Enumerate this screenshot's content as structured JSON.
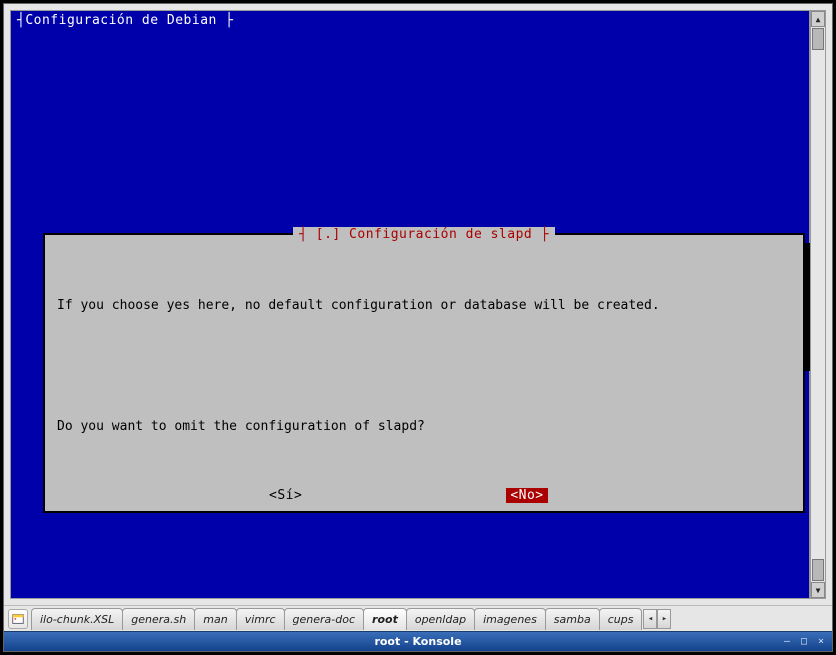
{
  "header": "Configuración de Debian",
  "dialog": {
    "title": "[.] Configuración de slapd",
    "line1": "If you choose yes here, no default configuration or database will be created.",
    "line2": "Do you want to omit the configuration of slapd?",
    "yes": "<Sí>",
    "no": "<No>"
  },
  "tabs": [
    "ilo-chunk.XSL",
    "genera.sh",
    "man",
    "vimrc",
    "genera-doc",
    "root",
    "openldap",
    "imagenes",
    "samba",
    "cups"
  ],
  "active_tab_index": 5,
  "title_bar": "root - Konsole",
  "controls": {
    "min": "—",
    "max": "□",
    "close": "×"
  }
}
